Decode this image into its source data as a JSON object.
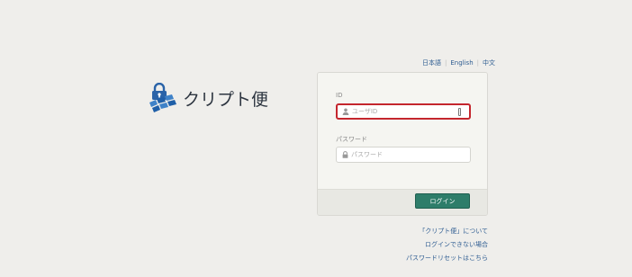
{
  "brand": {
    "name": "クリプト便"
  },
  "languages": [
    {
      "label": "日本語"
    },
    {
      "label": "English"
    },
    {
      "label": "中文"
    }
  ],
  "form": {
    "id_label": "ID",
    "id_placeholder": "ユーザID",
    "id_value": "",
    "password_label": "パスワード",
    "password_placeholder": "パスワード",
    "password_value": "",
    "login_label": "ログイン"
  },
  "links": [
    {
      "label": "「クリプト便」について"
    },
    {
      "label": "ログインできない場合"
    },
    {
      "label": "パスワードリセットはこちら"
    }
  ],
  "colors": {
    "background": "#efeeeb",
    "accent": "#2e7d6a",
    "focus_border": "#c4262e",
    "link": "#2f5d92",
    "logo_blue": "#1f5fa8"
  }
}
